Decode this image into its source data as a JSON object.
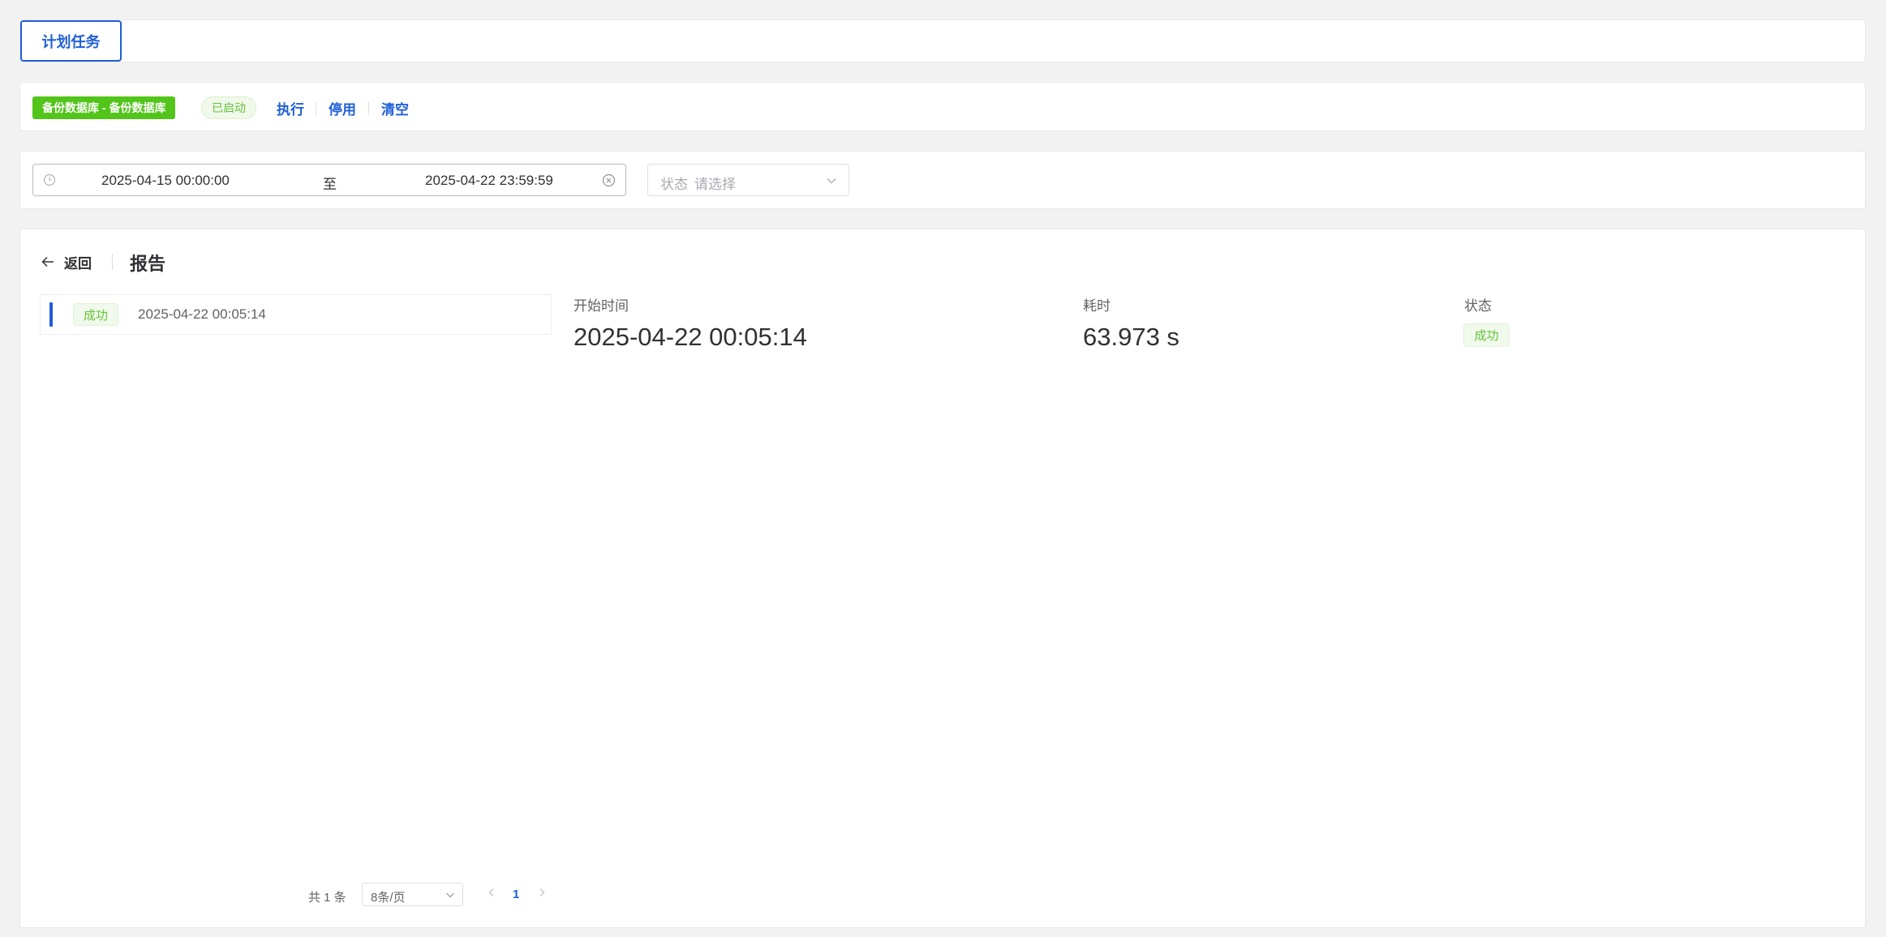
{
  "tabs": {
    "active": "计划任务"
  },
  "job": {
    "name": "备份数据库 - 备份数据库",
    "status": "已启动",
    "actions": {
      "execute": "执行",
      "disable": "停用",
      "clear": "清空"
    }
  },
  "filter": {
    "start": "2025-04-15 00:00:00",
    "separator": "至",
    "end": "2025-04-22 23:59:59",
    "status_label": "状态",
    "status_placeholder": "请选择"
  },
  "report": {
    "back_label": "返回",
    "title": "报告",
    "list": [
      {
        "status": "成功",
        "time": "2025-04-22 00:05:14"
      }
    ],
    "detail": {
      "start_label": "开始时间",
      "start_value": "2025-04-22 00:05:14",
      "duration_label": "耗时",
      "duration_value": "63.973 s",
      "status_label": "状态",
      "status_value": "成功"
    }
  },
  "pagination": {
    "total": "共 1 条",
    "page_size": "8条/页",
    "current": "1"
  },
  "colors": {
    "accent": "#1f5fd6",
    "success": "#67c23a",
    "job_tag": "#52c41a"
  }
}
